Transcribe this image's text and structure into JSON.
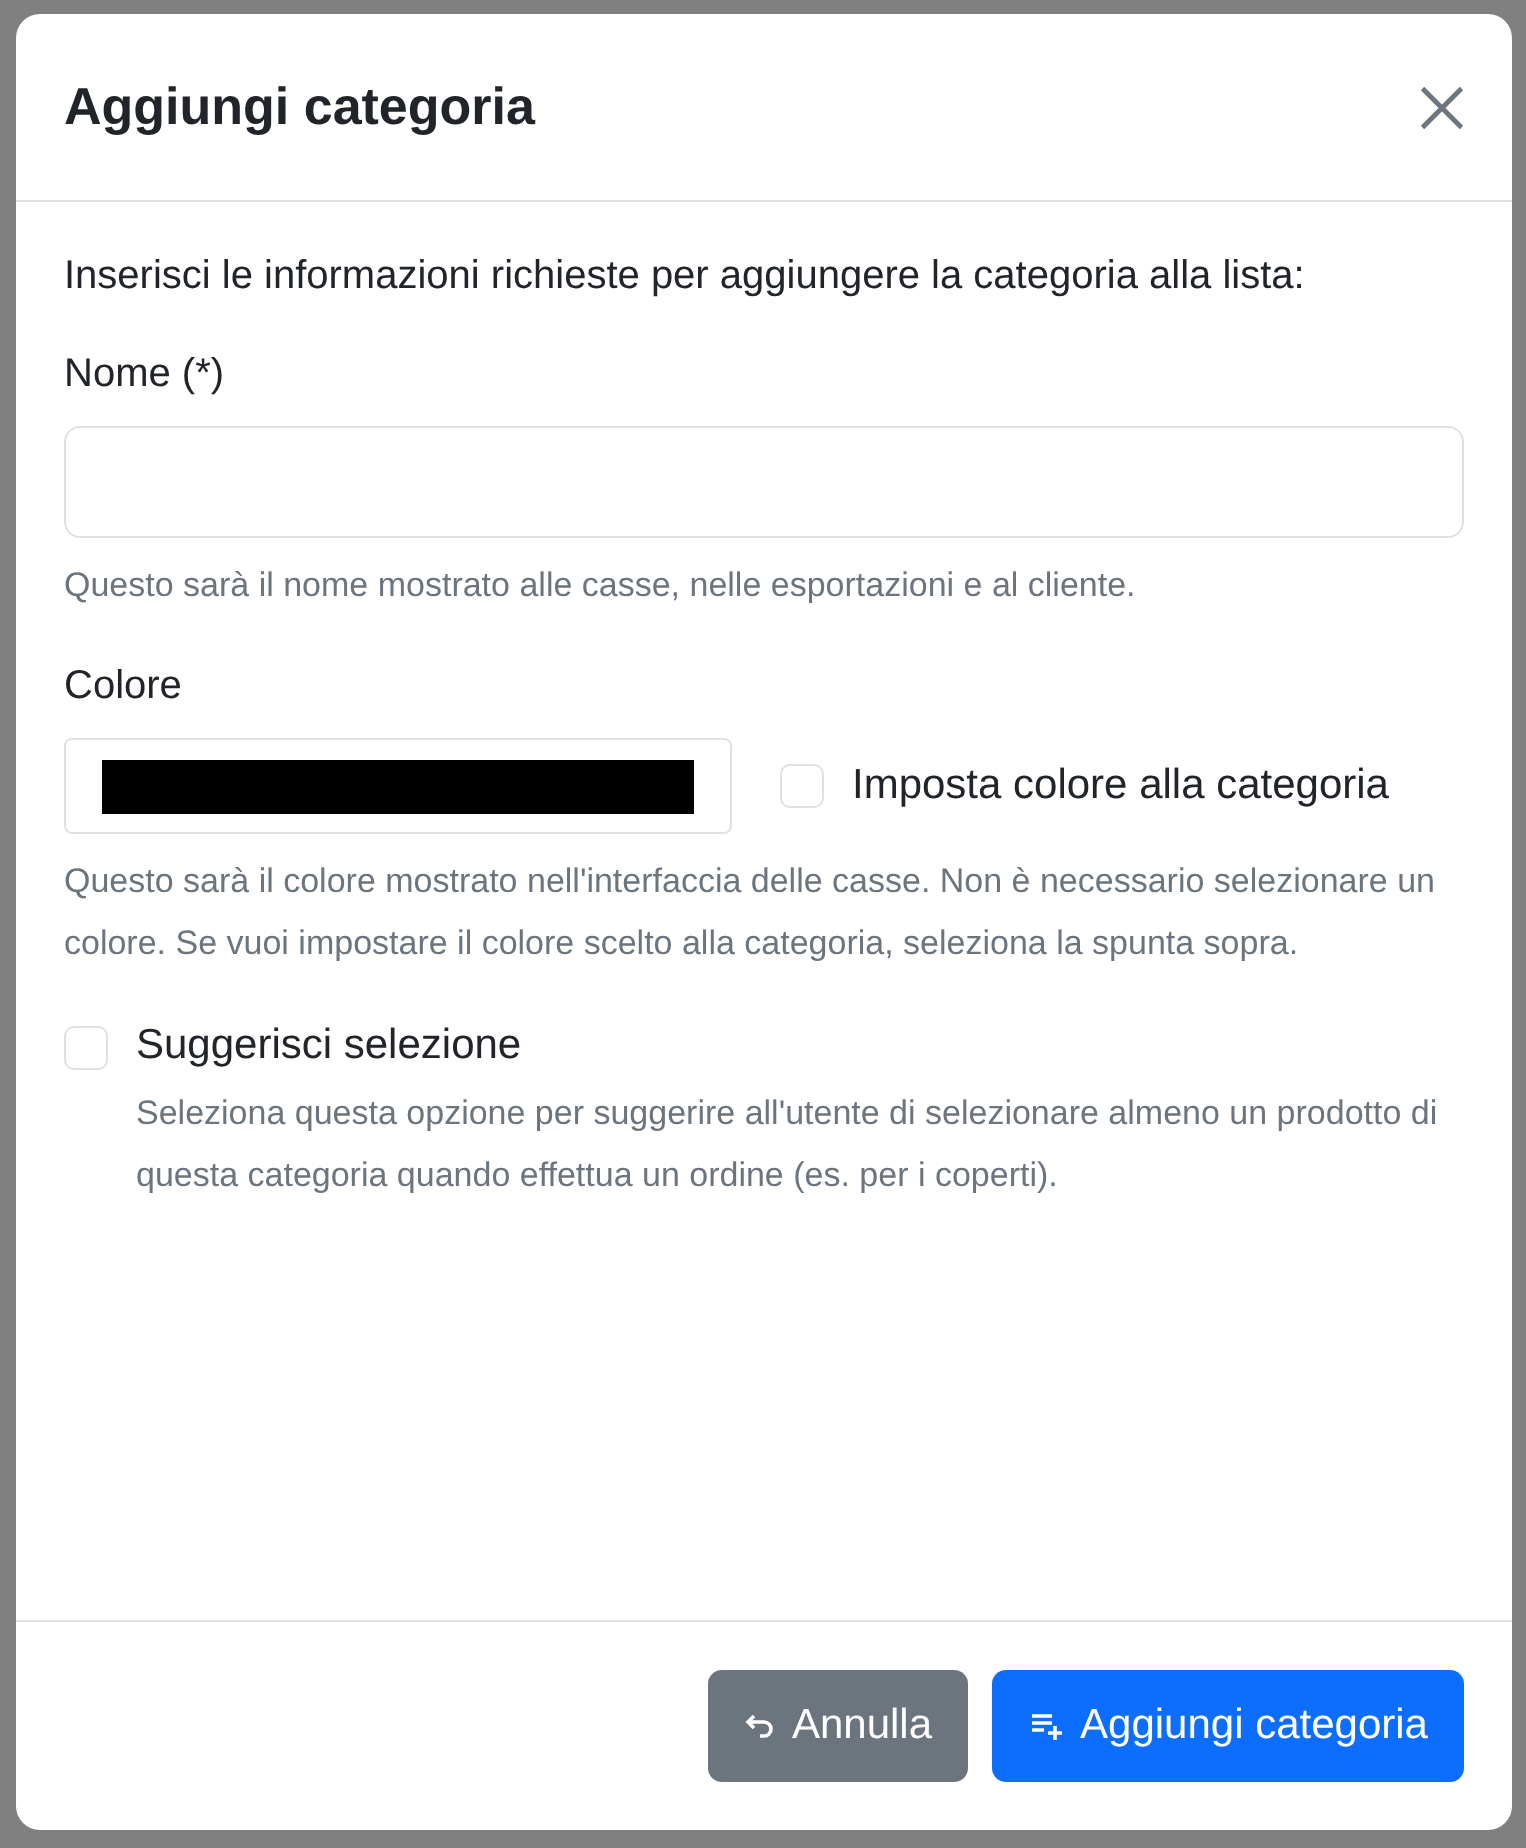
{
  "modal": {
    "title": "Aggiungi categoria"
  },
  "intro": "Inserisci le informazioni richieste per aggiungere la categoria alla lista:",
  "name_field": {
    "label": "Nome (*)",
    "help": "Questo sarà il nome mostrato alle casse, nelle esportazioni e al cliente."
  },
  "color_field": {
    "label": "Colore",
    "color": "#000000",
    "checkbox": {
      "label": "Imposta colore alla categoria",
      "checked": false
    },
    "help": "Questo sarà il colore mostrato nell'interfaccia delle casse. Non è necessario selezionare un colore. Se vuoi impostare il colore scelto alla categoria, seleziona la spunta sopra."
  },
  "suggest": {
    "label": "Suggerisci selezione",
    "checked": false,
    "help": "Seleziona questa opzione per suggerire all'utente di selezionare almeno un prodotto di questa categoria quando effettua un ordine (es. per i coperti)."
  },
  "buttons": [
    {
      "kind": "cancel",
      "label": "Annulla"
    },
    {
      "kind": "primary",
      "label": "Aggiungi categoria"
    }
  ]
}
